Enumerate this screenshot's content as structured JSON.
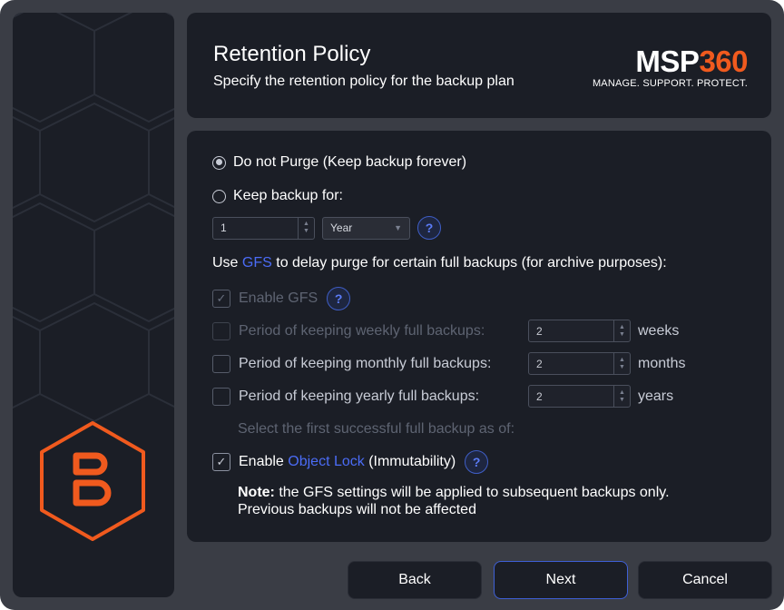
{
  "header": {
    "title": "Retention Policy",
    "subtitle": "Specify the retention policy for the backup plan",
    "logo": {
      "wordmark_msp": "MSP",
      "wordmark_num": "360",
      "tagline": "MANAGE. SUPPORT. PROTECT."
    }
  },
  "retention": {
    "do_not_purge_label": "Do not Purge (Keep backup forever)",
    "do_not_purge_selected": true,
    "keep_backup_label": "Keep backup for:",
    "keep_backup_selected": false,
    "keep_value": "1",
    "keep_unit": "Year"
  },
  "gfs": {
    "intro_prefix": "Use ",
    "intro_link": "GFS",
    "intro_suffix": " to delay purge for certain full backups (for archive purposes):",
    "enable_label": "Enable GFS",
    "enable_checked": true,
    "weekly_label": "Period of keeping weekly full backups:",
    "weekly_value": "2",
    "weekly_unit": "weeks",
    "monthly_label": "Period of keeping monthly full backups:",
    "monthly_value": "2",
    "monthly_unit": "months",
    "yearly_label": "Period of keeping yearly full backups:",
    "yearly_value": "2",
    "yearly_unit": "years",
    "first_backup_label": "Select the first successful full backup as of:"
  },
  "object_lock": {
    "prefix": "Enable ",
    "link": "Object Lock",
    "suffix": " (Immutability)",
    "checked": true
  },
  "note": {
    "label": "Note:",
    "line1": " the GFS settings will be applied to subsequent backups only.",
    "line2": "Previous backups will not be affected"
  },
  "help_glyph": "?",
  "buttons": {
    "back": "Back",
    "next": "Next",
    "cancel": "Cancel"
  },
  "colors": {
    "accent": "#f05a1e",
    "link": "#4b6cf6",
    "background": "#1b1e26"
  }
}
